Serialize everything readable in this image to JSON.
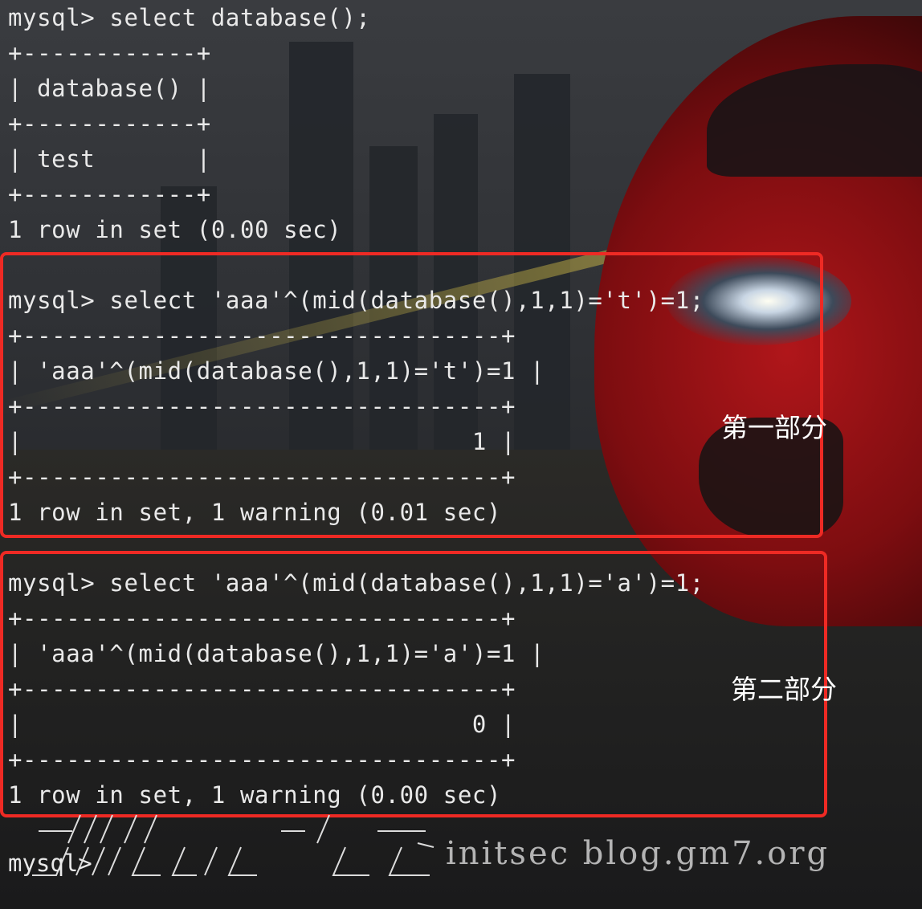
{
  "terminal": {
    "lines": [
      "mysql> select database();",
      "+------------+",
      "| database() |",
      "+------------+",
      "| test       |",
      "+------------+",
      "1 row in set (0.00 sec)",
      "",
      "mysql> select 'aaa'^(mid(database(),1,1)='t')=1;",
      "+---------------------------------+",
      "| 'aaa'^(mid(database(),1,1)='t')=1 |",
      "+---------------------------------+",
      "|                               1 |",
      "+---------------------------------+",
      "1 row in set, 1 warning (0.01 sec)",
      "",
      "mysql> select 'aaa'^(mid(database(),1,1)='a')=1;",
      "+---------------------------------+",
      "| 'aaa'^(mid(database(),1,1)='a')=1 |",
      "+---------------------------------+",
      "|                               0 |",
      "+---------------------------------+",
      "1 row in set, 1 warning (0.00 sec)"
    ],
    "final_prompt": "mysql>"
  },
  "annotations": {
    "part1": "第一部分",
    "part2": "第二部分"
  },
  "watermark": {
    "text": "initsec blog.gm7.org"
  },
  "colors": {
    "box_border": "#ee2a24",
    "terminal_text": "#e9e9e9"
  }
}
